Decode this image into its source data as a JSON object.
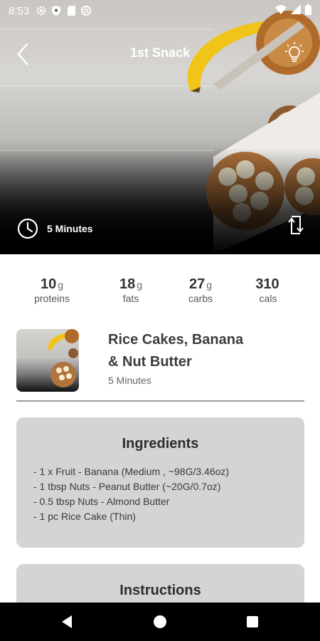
{
  "status_bar": {
    "time": "8:53",
    "left_icons": [
      "settings-icon",
      "shield-icon",
      "sim-card-icon",
      "circle-a-icon"
    ],
    "right_icons": [
      "wifi-icon",
      "cellular-icon",
      "battery-icon"
    ]
  },
  "header": {
    "title": "1st Snack",
    "back_icon": "back-chevron-icon",
    "tip_icon": "lightbulb-icon"
  },
  "hero": {
    "prep_time": "5 Minutes",
    "clock_icon": "clock-icon",
    "swap_icon": "swap-icon"
  },
  "macros": [
    {
      "value": "10",
      "unit": "g",
      "name": "proteins"
    },
    {
      "value": "18",
      "unit": "g",
      "name": "fats"
    },
    {
      "value": "27",
      "unit": "g",
      "name": "carbs"
    },
    {
      "value": "310",
      "unit": "",
      "name": "cals"
    }
  ],
  "recipe": {
    "title_line1": "Rice Cakes, Banana",
    "title_line2": "& Nut Butter",
    "time": "5 Minutes"
  },
  "ingredients": {
    "heading": "Ingredients",
    "items": [
      "- 1 x Fruit - Banana (Medium , ~98G/3.46oz)",
      "- 1 tbsp Nuts - Peanut Butter (~20G/0.7oz)",
      "- 0.5 tbsp Nuts - Almond Butter",
      "- 1 pc Rice Cake (Thin)"
    ]
  },
  "instructions": {
    "heading": "Instructions"
  },
  "nav": {
    "back_icon": "nav-back-icon",
    "home_icon": "nav-home-icon",
    "recents_icon": "nav-recents-icon"
  },
  "colors": {
    "card_bg": "#d4d4d4",
    "divider": "#9a9a9a",
    "navbar": "#000000"
  }
}
